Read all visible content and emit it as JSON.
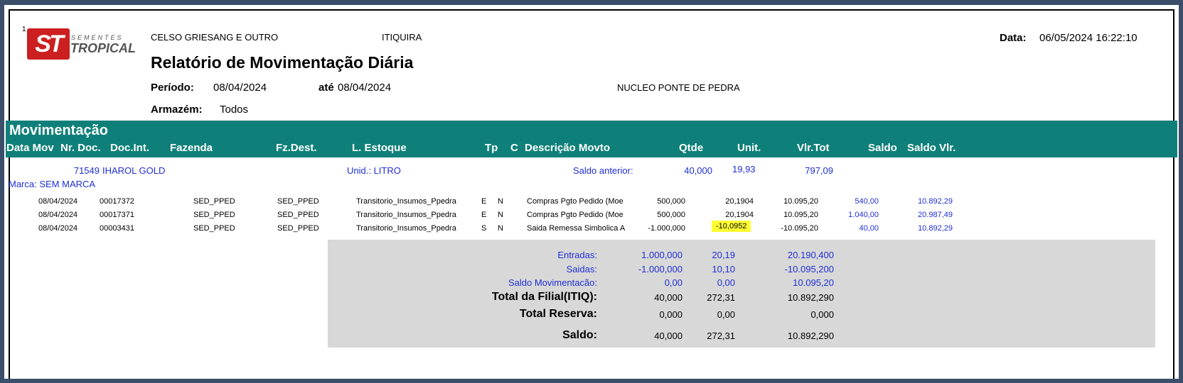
{
  "header": {
    "logo_marker": "1",
    "logo_text": "ST",
    "logo_top": "SEMENTES",
    "logo_bottom": "TROPICAL",
    "company": "CELSO GRIESANG E OUTRO",
    "city": "ITIQUIRA",
    "date_label": "Data:",
    "date_value": "06/05/2024 16:22:10",
    "title": "Relatório de Movimentação Diária",
    "period_label": "Período:",
    "period_start": "08/04/2024",
    "until_label": "até",
    "period_end": "08/04/2024",
    "nucleo": "NUCLEO PONTE DE PEDRA",
    "warehouse_label": "Armazém:",
    "warehouse_value": "Todos"
  },
  "section_title": "Movimentação",
  "columns": [
    "Data Mov",
    "Nr. Doc.",
    "Doc.Int.",
    "Fazenda",
    "Fz.Dest.",
    "L. Estoque",
    "Tp",
    "C",
    "Descrição Movto",
    "Qtde",
    "Unit.",
    "Vlr.Tot",
    "Saldo",
    "Saldo Vlr."
  ],
  "product": {
    "code": "71549",
    "name": "IHAROL GOLD",
    "unit": "Unid.:  LITRO",
    "prev_balance_label": "Saldo anterior:",
    "prev_qty": "40,000",
    "prev_unit": "19,93",
    "prev_total": "797,09",
    "brand": "Marca: SEM MARCA"
  },
  "rows": [
    {
      "date": "08/04/2024",
      "doc": "00017372",
      "fazenda": "SED_PPED",
      "fzdest": "SED_PPED",
      "estoque": "Transitorio_Insumos_Ppedra",
      "tp": "E",
      "c": "N",
      "desc": "Compras Pgto Pedido (Moe",
      "qtde": "500,000",
      "unit": "20,1904",
      "vlrtot": "10.095,20",
      "saldo": "540,00",
      "saldovlr": "10.892,29"
    },
    {
      "date": "08/04/2024",
      "doc": "00017371",
      "fazenda": "SED_PPED",
      "fzdest": "SED_PPED",
      "estoque": "Transitorio_Insumos_Ppedra",
      "tp": "E",
      "c": "N",
      "desc": "Compras Pgto Pedido (Moe",
      "qtde": "500,000",
      "unit": "20,1904",
      "vlrtot": "10.095,20",
      "saldo": "1.040,00",
      "saldovlr": "20.987,49"
    },
    {
      "date": "08/04/2024",
      "doc": "00003431",
      "fazenda": "SED_PPED",
      "fzdest": "SED_PPED",
      "estoque": "Transitorio_Insumos_Ppedra",
      "tp": "S",
      "c": "N",
      "desc": "Saida Remessa Simbolica A",
      "qtde": "-1.000,000",
      "unit": "-10,0952",
      "vlrtot": "-10.095,20",
      "saldo": "40,00",
      "saldovlr": "10.892,29"
    }
  ],
  "totals": [
    {
      "label": "Entradas:",
      "qty": "1.000,000",
      "unit": "20,19",
      "total": "20.190,400",
      "style": "blue"
    },
    {
      "label": "Saidas:",
      "qty": "-1.000,000",
      "unit": "10,10",
      "total": "-10.095,200",
      "style": "blue"
    },
    {
      "label": "Saldo Movimentacão:",
      "qty": "0,00",
      "unit": "0,00",
      "total": "10.095,20",
      "style": "blue"
    },
    {
      "label": "Total da Filial(ITIQ):",
      "qty": "40,000",
      "unit": "272,31",
      "total": "10.892,290",
      "style": "bold"
    },
    {
      "label": "Total Reserva:",
      "qty": "0,000",
      "unit": "0,00",
      "total": "0,000",
      "style": "bold"
    },
    {
      "label": "Saldo:",
      "qty": "40,000",
      "unit": "272,31",
      "total": "10.892,290",
      "style": "bold"
    }
  ],
  "colors": {
    "band": "#0f8079",
    "highlight": "#ffff33",
    "blue_text": "#1f2fd6",
    "summary_bg": "#d8d8d8"
  }
}
